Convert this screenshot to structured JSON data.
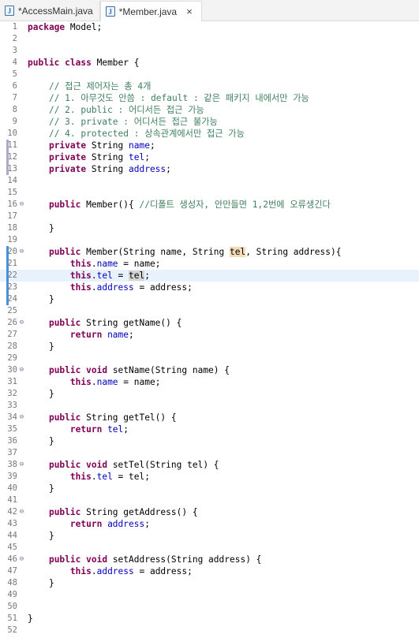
{
  "tabs": [
    {
      "label": "*AccessMain.java",
      "icon": "java-file-icon",
      "active": false
    },
    {
      "label": "*Member.java",
      "icon": "java-file-icon",
      "active": true,
      "close": "×"
    }
  ],
  "editor": {
    "current_line": 22,
    "fold_lines": [
      16,
      20,
      26,
      30,
      34,
      38,
      42,
      46
    ],
    "changed_lines_blue": [
      20,
      21,
      22,
      23,
      24
    ],
    "changed_lines_gray": [
      11,
      12,
      13
    ],
    "lines": [
      {
        "n": "1",
        "t": [
          [
            "kw",
            "package"
          ],
          [
            "p",
            " Model;"
          ]
        ]
      },
      {
        "n": "2",
        "t": []
      },
      {
        "n": "3",
        "t": []
      },
      {
        "n": "4",
        "t": [
          [
            "kw",
            "public"
          ],
          [
            "p",
            " "
          ],
          [
            "kw",
            "class"
          ],
          [
            "p",
            " Member {"
          ]
        ]
      },
      {
        "n": "5",
        "t": []
      },
      {
        "n": "6",
        "t": [
          [
            "p",
            "    "
          ],
          [
            "cmt",
            "// 접근 제어자는 총 4개"
          ]
        ]
      },
      {
        "n": "7",
        "t": [
          [
            "p",
            "    "
          ],
          [
            "cmt",
            "// 1. 아무것도 안씀 : default : 같은 패키지 내에서만 가능"
          ]
        ]
      },
      {
        "n": "8",
        "t": [
          [
            "p",
            "    "
          ],
          [
            "cmt",
            "// 2. public : 어디서든 접근 가능"
          ]
        ]
      },
      {
        "n": "9",
        "t": [
          [
            "p",
            "    "
          ],
          [
            "cmt",
            "// 3. private : 어디서든 접근 불가능"
          ]
        ]
      },
      {
        "n": "10",
        "t": [
          [
            "p",
            "    "
          ],
          [
            "cmt",
            "// 4. protected : 상속관계에서만 접근 가능"
          ]
        ]
      },
      {
        "n": "11",
        "t": [
          [
            "p",
            "    "
          ],
          [
            "kw",
            "private"
          ],
          [
            "p",
            " String "
          ],
          [
            "fld",
            "name"
          ],
          [
            "p",
            ";"
          ]
        ]
      },
      {
        "n": "12",
        "t": [
          [
            "p",
            "    "
          ],
          [
            "kw",
            "private"
          ],
          [
            "p",
            " String "
          ],
          [
            "fld",
            "tel"
          ],
          [
            "p",
            ";"
          ]
        ]
      },
      {
        "n": "13",
        "t": [
          [
            "p",
            "    "
          ],
          [
            "kw",
            "private"
          ],
          [
            "p",
            " String "
          ],
          [
            "fld",
            "address"
          ],
          [
            "p",
            ";"
          ]
        ]
      },
      {
        "n": "14",
        "t": []
      },
      {
        "n": "15",
        "t": []
      },
      {
        "n": "16",
        "t": [
          [
            "p",
            "    "
          ],
          [
            "kw",
            "public"
          ],
          [
            "p",
            " Member(){ "
          ],
          [
            "cmt",
            "//디폴트 생성자, 안만들면 1,2번에 오류생긴다"
          ]
        ]
      },
      {
        "n": "17",
        "t": []
      },
      {
        "n": "18",
        "t": [
          [
            "p",
            "    }"
          ]
        ]
      },
      {
        "n": "19",
        "t": []
      },
      {
        "n": "20",
        "t": [
          [
            "p",
            "    "
          ],
          [
            "kw",
            "public"
          ],
          [
            "p",
            " Member(String name, String "
          ],
          [
            "occ",
            "tel"
          ],
          [
            "p",
            ", String address){"
          ]
        ]
      },
      {
        "n": "21",
        "t": [
          [
            "p",
            "        "
          ],
          [
            "kw",
            "this"
          ],
          [
            "p",
            "."
          ],
          [
            "fld",
            "name"
          ],
          [
            "p",
            " = name;"
          ]
        ]
      },
      {
        "n": "22",
        "t": [
          [
            "p",
            "        "
          ],
          [
            "kw",
            "this"
          ],
          [
            "p",
            "."
          ],
          [
            "fld",
            "tel"
          ],
          [
            "p",
            " = "
          ],
          [
            "occ2",
            "tel"
          ],
          [
            "p",
            ";"
          ]
        ]
      },
      {
        "n": "23",
        "t": [
          [
            "p",
            "        "
          ],
          [
            "kw",
            "this"
          ],
          [
            "p",
            "."
          ],
          [
            "fld",
            "address"
          ],
          [
            "p",
            " = address;"
          ]
        ]
      },
      {
        "n": "24",
        "t": [
          [
            "p",
            "    }"
          ]
        ]
      },
      {
        "n": "25",
        "t": []
      },
      {
        "n": "26",
        "t": [
          [
            "p",
            "    "
          ],
          [
            "kw",
            "public"
          ],
          [
            "p",
            " String getName() {"
          ]
        ]
      },
      {
        "n": "27",
        "t": [
          [
            "p",
            "        "
          ],
          [
            "kw",
            "return"
          ],
          [
            "p",
            " "
          ],
          [
            "fld",
            "name"
          ],
          [
            "p",
            ";"
          ]
        ]
      },
      {
        "n": "28",
        "t": [
          [
            "p",
            "    }"
          ]
        ]
      },
      {
        "n": "29",
        "t": []
      },
      {
        "n": "30",
        "t": [
          [
            "p",
            "    "
          ],
          [
            "kw",
            "public"
          ],
          [
            "p",
            " "
          ],
          [
            "kw",
            "void"
          ],
          [
            "p",
            " setName(String name) {"
          ]
        ]
      },
      {
        "n": "31",
        "t": [
          [
            "p",
            "        "
          ],
          [
            "kw",
            "this"
          ],
          [
            "p",
            "."
          ],
          [
            "fld",
            "name"
          ],
          [
            "p",
            " = name;"
          ]
        ]
      },
      {
        "n": "32",
        "t": [
          [
            "p",
            "    }"
          ]
        ]
      },
      {
        "n": "33",
        "t": []
      },
      {
        "n": "34",
        "t": [
          [
            "p",
            "    "
          ],
          [
            "kw",
            "public"
          ],
          [
            "p",
            " String getTel() {"
          ]
        ]
      },
      {
        "n": "35",
        "t": [
          [
            "p",
            "        "
          ],
          [
            "kw",
            "return"
          ],
          [
            "p",
            " "
          ],
          [
            "fld",
            "tel"
          ],
          [
            "p",
            ";"
          ]
        ]
      },
      {
        "n": "36",
        "t": [
          [
            "p",
            "    }"
          ]
        ]
      },
      {
        "n": "37",
        "t": []
      },
      {
        "n": "38",
        "t": [
          [
            "p",
            "    "
          ],
          [
            "kw",
            "public"
          ],
          [
            "p",
            " "
          ],
          [
            "kw",
            "void"
          ],
          [
            "p",
            " setTel(String tel) {"
          ]
        ]
      },
      {
        "n": "39",
        "t": [
          [
            "p",
            "        "
          ],
          [
            "kw",
            "this"
          ],
          [
            "p",
            "."
          ],
          [
            "fld",
            "tel"
          ],
          [
            "p",
            " = tel;"
          ]
        ]
      },
      {
        "n": "40",
        "t": [
          [
            "p",
            "    }"
          ]
        ]
      },
      {
        "n": "41",
        "t": []
      },
      {
        "n": "42",
        "t": [
          [
            "p",
            "    "
          ],
          [
            "kw",
            "public"
          ],
          [
            "p",
            " String getAddress() {"
          ]
        ]
      },
      {
        "n": "43",
        "t": [
          [
            "p",
            "        "
          ],
          [
            "kw",
            "return"
          ],
          [
            "p",
            " "
          ],
          [
            "fld",
            "address"
          ],
          [
            "p",
            ";"
          ]
        ]
      },
      {
        "n": "44",
        "t": [
          [
            "p",
            "    }"
          ]
        ]
      },
      {
        "n": "45",
        "t": []
      },
      {
        "n": "46",
        "t": [
          [
            "p",
            "    "
          ],
          [
            "kw",
            "public"
          ],
          [
            "p",
            " "
          ],
          [
            "kw",
            "void"
          ],
          [
            "p",
            " setAddress(String address) {"
          ]
        ]
      },
      {
        "n": "47",
        "t": [
          [
            "p",
            "        "
          ],
          [
            "kw",
            "this"
          ],
          [
            "p",
            "."
          ],
          [
            "fld",
            "address"
          ],
          [
            "p",
            " = address;"
          ]
        ]
      },
      {
        "n": "48",
        "t": [
          [
            "p",
            "    }"
          ]
        ]
      },
      {
        "n": "49",
        "t": []
      },
      {
        "n": "50",
        "t": []
      },
      {
        "n": "51",
        "t": [
          [
            "p",
            "}"
          ]
        ]
      },
      {
        "n": "52",
        "t": []
      }
    ]
  },
  "colors": {
    "keyword": "#7f0055",
    "field": "#0000c0",
    "comment": "#3f7f5f",
    "current_line": "#e8f2fe",
    "change_blue": "#4a90d9",
    "change_gray": "#b0a8c8"
  }
}
